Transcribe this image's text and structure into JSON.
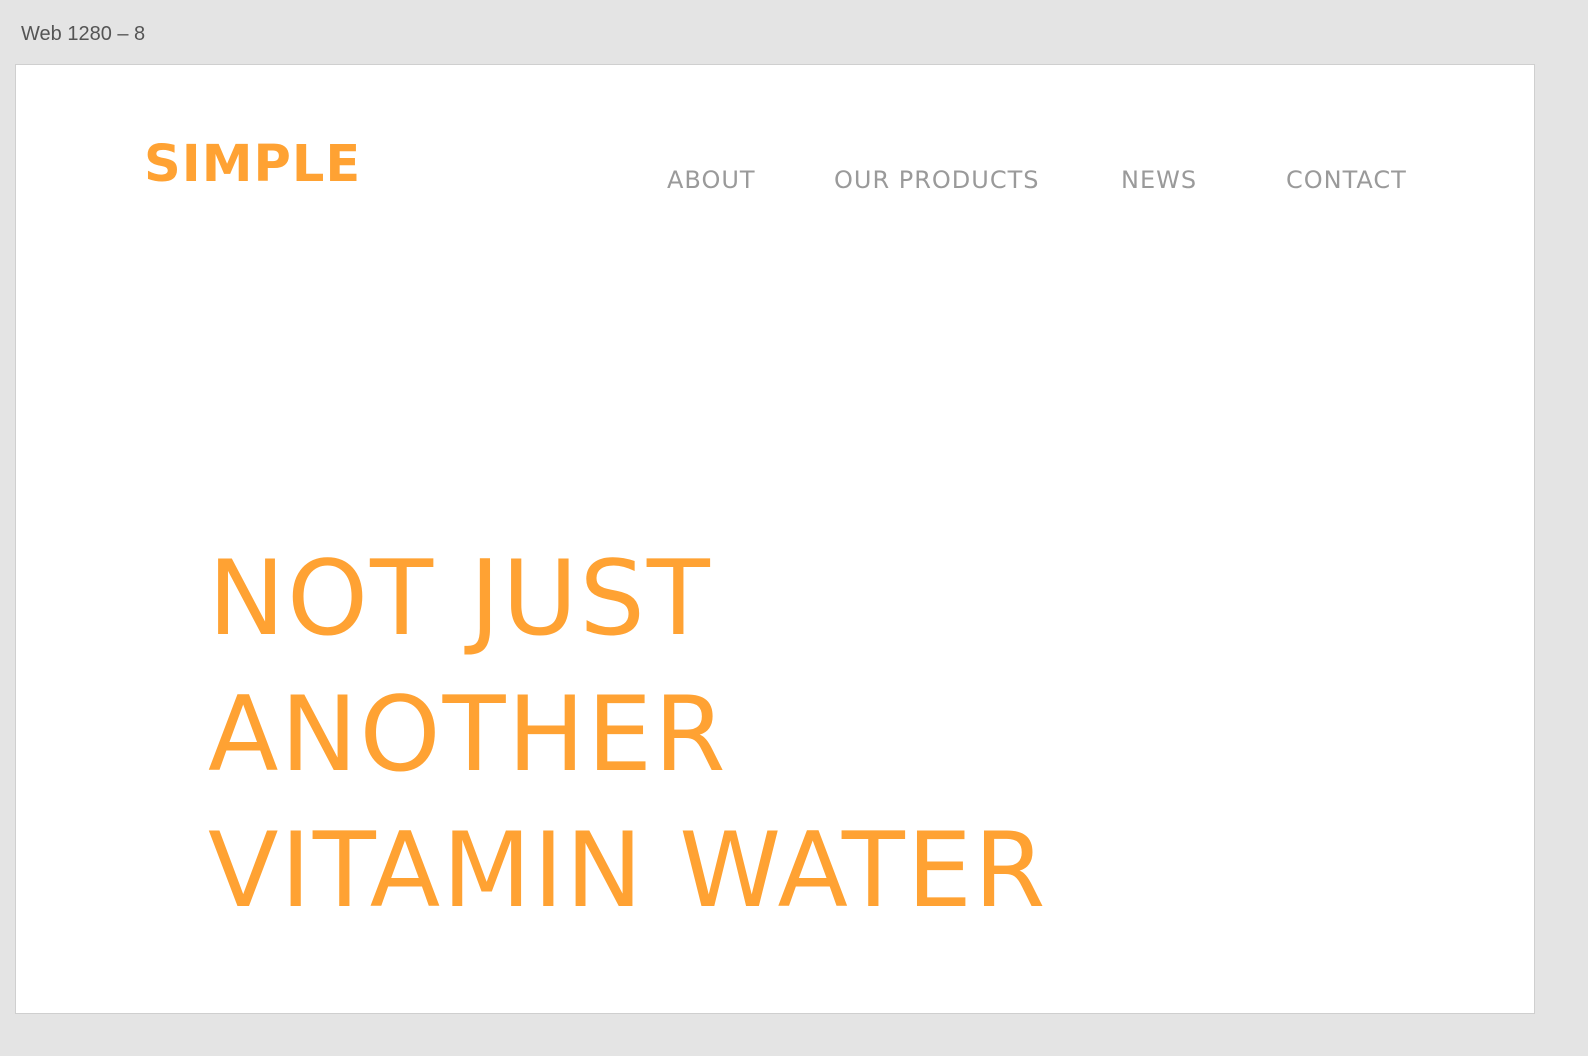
{
  "artboard": {
    "label": "Web 1280 – 8"
  },
  "header": {
    "logo_text": "SIMPLE",
    "nav": [
      {
        "label": "ABOUT"
      },
      {
        "label": "OUR PRODUCTS"
      },
      {
        "label": "NEWS"
      },
      {
        "label": "CONTACT"
      }
    ]
  },
  "hero": {
    "lines": [
      "NOT JUST",
      "ANOTHER",
      "VITAMIN WATER"
    ]
  },
  "colors": {
    "accent": "#ffa233",
    "nav_text": "#9a9a9a",
    "canvas_bg": "#e4e4e4",
    "artboard_bg": "#ffffff"
  }
}
